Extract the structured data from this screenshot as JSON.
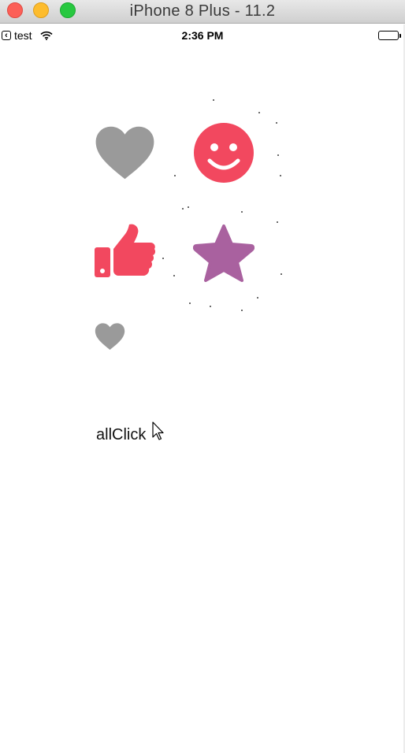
{
  "window": {
    "title": "iPhone 8 Plus - 11.2"
  },
  "status_bar": {
    "carrier": "test",
    "time": "2:36 PM"
  },
  "buttons": {
    "heart_large": "heart-icon",
    "smile": "smile-icon",
    "thumbs_up": "thumbs-up-icon",
    "star": "star-icon",
    "heart_small": "heart-icon"
  },
  "colors": {
    "gray": "#9a9a9a",
    "red": "#f2485f",
    "purple": "#a9619f"
  },
  "main": {
    "all_click_label": "allClick"
  }
}
